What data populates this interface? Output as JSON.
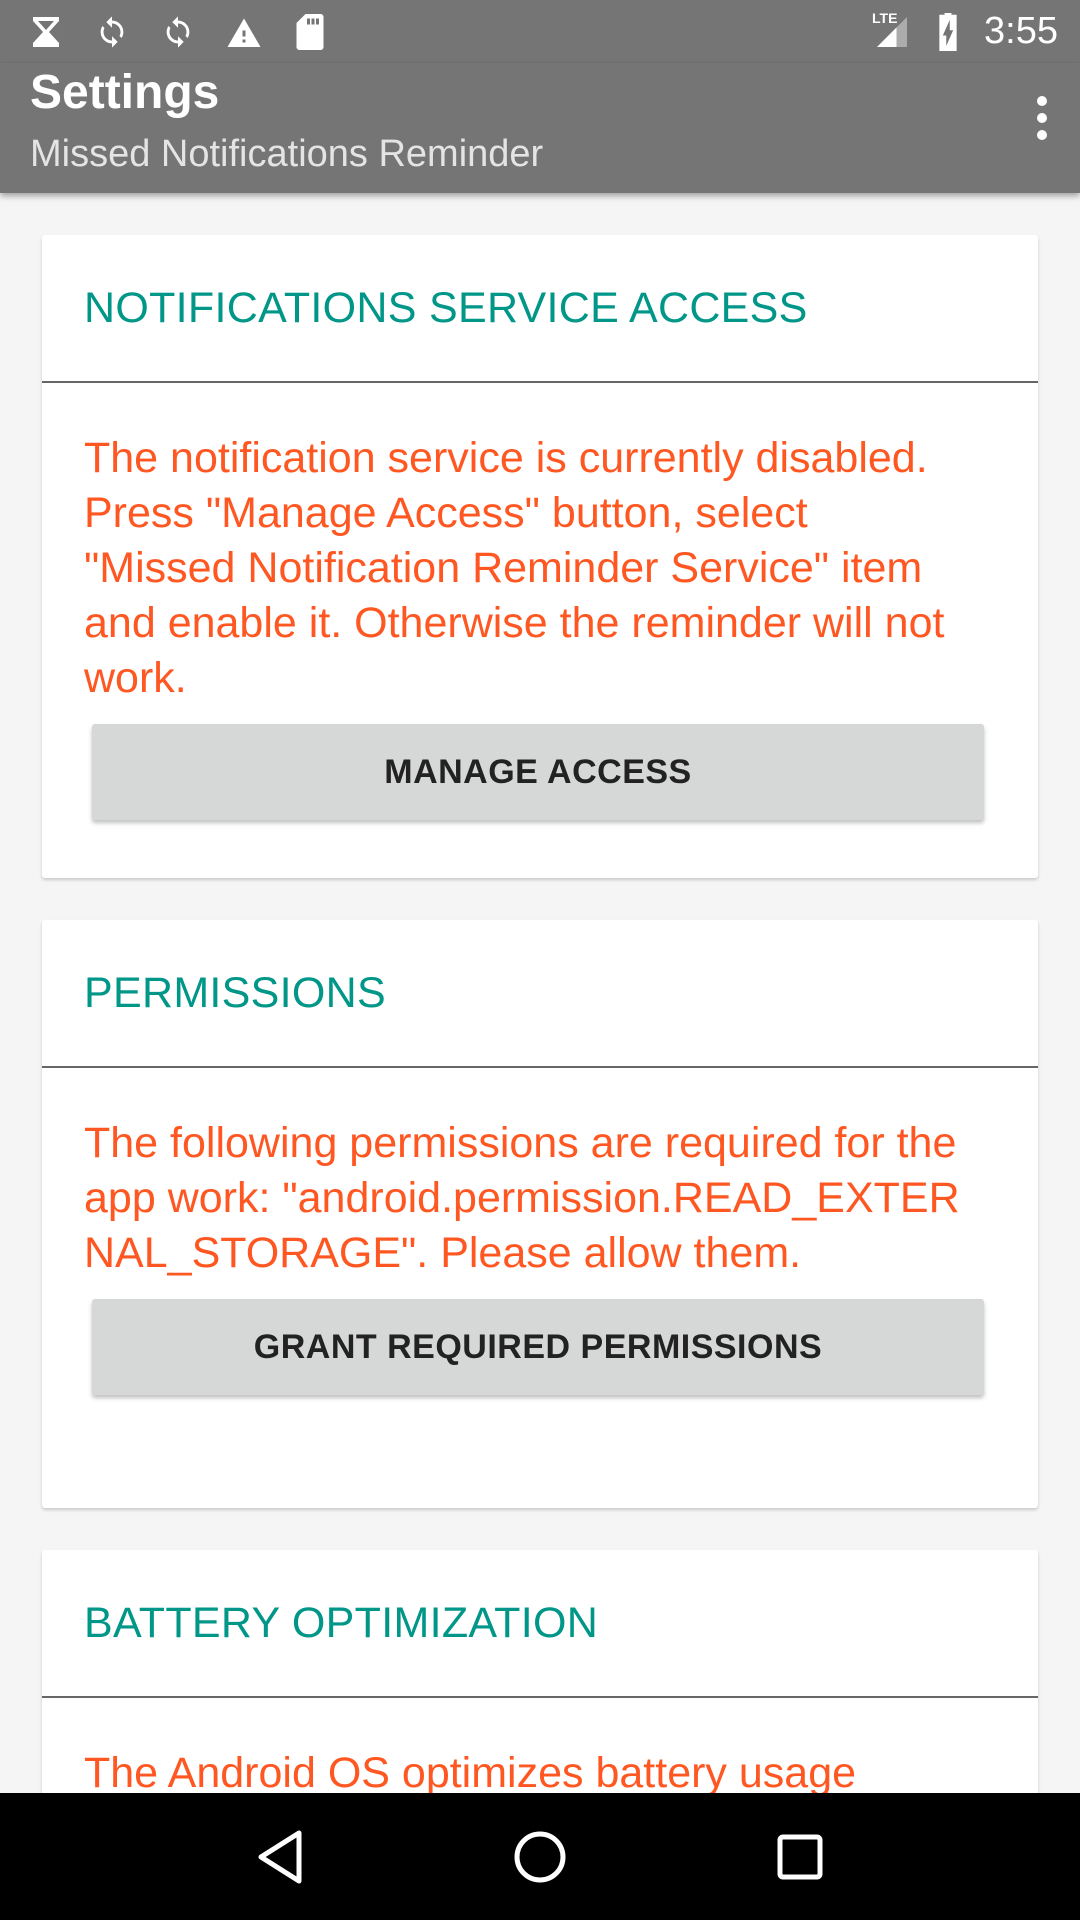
{
  "status_bar": {
    "time": "3:55",
    "network_label": "LTE",
    "left_icons": [
      "hourglass-icon",
      "sync-icon",
      "sync-icon",
      "warning-icon",
      "sd-card-icon"
    ],
    "right_icons": [
      "signal-icon",
      "battery-charging-icon"
    ]
  },
  "app_bar": {
    "title": "Settings",
    "subtitle": "Missed Notifications Reminder",
    "menu_icon": "more-vert-icon"
  },
  "cards": [
    {
      "title": "NOTIFICATIONS SERVICE ACCESS",
      "text": "The notification service is currently disabled. Press \"Manage Access\" button, select \"Missed Notification Reminder Service\" item and enable it. Otherwise the reminder will not work.",
      "button_label": "MANAGE ACCESS"
    },
    {
      "title": "PERMISSIONS",
      "text": "The following permissions are required for the app work: \"android.permission.READ_EXTERNAL_STORAGE\". Please allow them.",
      "button_label": "GRANT REQUIRED PERMISSIONS"
    },
    {
      "title": "BATTERY OPTIMIZATION",
      "text": "The Android OS optimizes battery usage"
    }
  ],
  "nav_bar": {
    "icons": [
      "back-icon",
      "home-icon",
      "recents-icon"
    ]
  },
  "colors": {
    "app_bar": "#757575",
    "section_title": "#009688",
    "warning_text": "#ff5722",
    "button_bg": "#d6d7d7"
  }
}
